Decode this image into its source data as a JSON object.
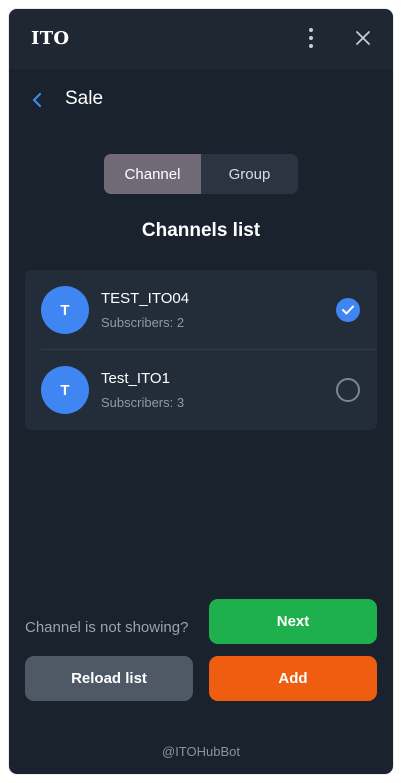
{
  "app": {
    "title": "ITO"
  },
  "header": {
    "page_title": "Sale",
    "icons": {
      "menu": "more-vertical-icon",
      "close": "close-icon",
      "back": "chevron-left-icon"
    }
  },
  "tabs": [
    {
      "label": "Channel",
      "active": true
    },
    {
      "label": "Group",
      "active": false
    }
  ],
  "list": {
    "title": "Channels list",
    "items": [
      {
        "avatar_letter": "T",
        "name": "TEST_ITO04",
        "subscribers": "Subscribers: 2",
        "selected": true
      },
      {
        "avatar_letter": "T",
        "name": "Test_ITO1",
        "subscribers": "Subscribers: 3",
        "selected": false
      }
    ]
  },
  "actions": {
    "hint": "Channel is not showing?",
    "next_label": "Next",
    "reload_label": "Reload list",
    "add_label": "Add"
  },
  "footer": {
    "text": "@ITOHubBot"
  },
  "colors": {
    "background": "#1a222d",
    "accent_blue": "#3f86f2",
    "next_green": "#1db04c",
    "add_orange": "#ee5d10",
    "reload_gray": "#4f5966"
  }
}
